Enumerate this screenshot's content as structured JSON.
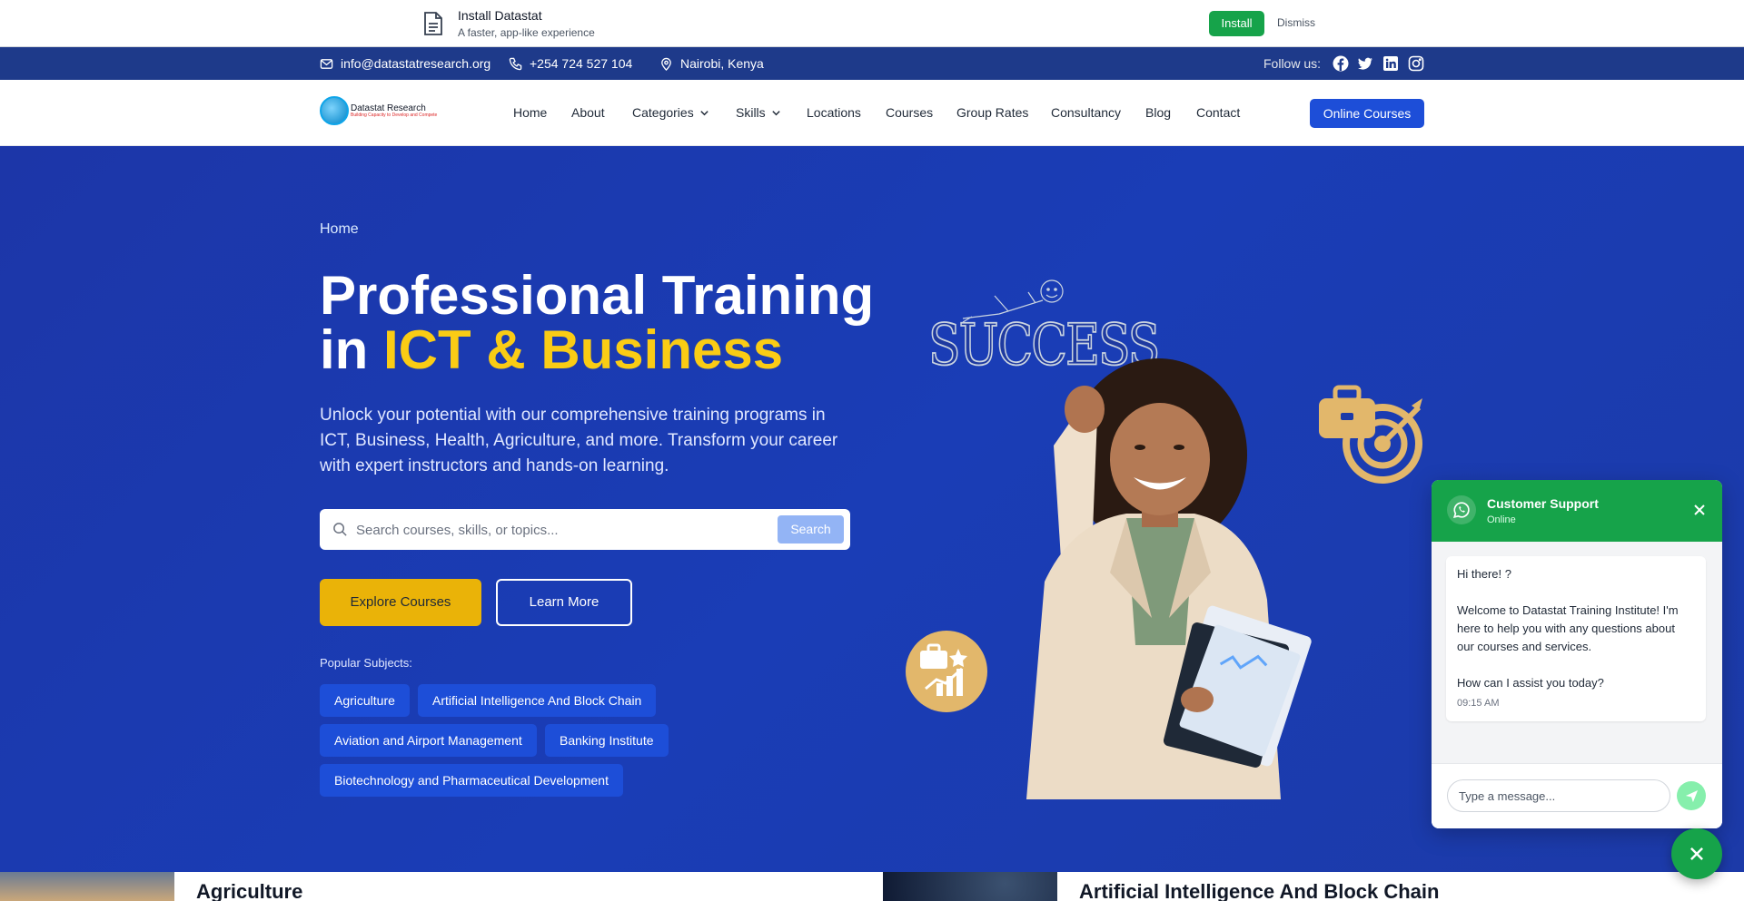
{
  "install_bar": {
    "title": "Install Datastat",
    "subtitle": "A faster, app-like experience",
    "install_label": "Install",
    "dismiss_label": "Dismiss"
  },
  "contact_bar": {
    "email": "info@datastatresearch.org",
    "phone": "+254 724 527 104",
    "location": "Nairobi, Kenya",
    "follow_label": "Follow us:",
    "social_icons": [
      "facebook-icon",
      "twitter-icon",
      "linkedin-icon",
      "instagram-icon"
    ]
  },
  "navbar": {
    "logo_text": "Datastat Research",
    "logo_tagline": "Building Capacity to Develop and Compete",
    "links": [
      "Home",
      "About",
      "Categories",
      "Skills",
      "Locations",
      "Courses",
      "Group Rates",
      "Consultancy",
      "Blog",
      "Contact"
    ],
    "cta_label": "Online Courses"
  },
  "hero": {
    "breadcrumb": "Home",
    "title_line1": "Professional Training",
    "title_in": "in ",
    "title_accent": "ICT & Business",
    "description": "Unlock your potential with our comprehensive training programs in ICT, Business, Health, Agriculture, and more. Transform your career with expert instructors and hands-on learning.",
    "search_placeholder": "Search courses, skills, or topics...",
    "search_button": "Search",
    "explore_button": "Explore Courses",
    "learn_button": "Learn More",
    "popular_label": "Popular Subjects:",
    "subjects": [
      "Agriculture",
      "Artificial Intelligence And Block Chain",
      "Aviation and Airport Management",
      "Banking Institute",
      "Biotechnology and Pharmaceutical Development"
    ],
    "illustration_text": "SUCCESS"
  },
  "cards": {
    "first_title": "Agriculture",
    "second_title": "Artificial Intelligence And Block Chain"
  },
  "chat": {
    "title": "Customer Support",
    "status": "Online",
    "greeting": "Hi there! ?",
    "welcome": "Welcome to Datastat Training Institute! I'm here to help you with any questions about our courses and services.",
    "question": "How can I assist you today?",
    "time": "09:15 AM",
    "input_placeholder": "Type a message..."
  },
  "colors": {
    "hero_bg": "#1a3bb0",
    "accent_yellow": "#eab308",
    "primary_blue": "#1d4ed8",
    "whatsapp_green": "#16a34a"
  }
}
